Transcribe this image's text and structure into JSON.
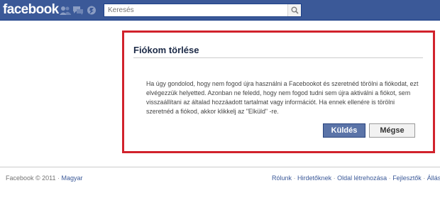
{
  "header": {
    "logo": "facebook",
    "search": {
      "placeholder": "Keresés",
      "value": ""
    }
  },
  "dialog": {
    "title": "Fiókom törlése",
    "body": "Ha úgy gondolod, hogy nem fogod újra használni a Facebookot és szeretnéd törölni a fiókodat, ezt elvégezzük helyetted. Azonban ne feledd, hogy nem fogod tudni sem újra aktiválni a fiókot, sem visszaállítani az általad hozzáadott tartalmat vagy információt. Ha ennek ellenére is törölni szeretnéd a fiókod, akkor klikkelj az \"Elküld\" -re.",
    "submit_label": "Küldés",
    "cancel_label": "Mégse"
  },
  "footer": {
    "copyright": "Facebook © 2011",
    "separator": "·",
    "language": "Magyar",
    "links": [
      "Rólunk",
      "Hirdetőknek",
      "Oldal létrehozása",
      "Fejlesztők",
      "Álláslehe"
    ]
  },
  "colors": {
    "brand": "#3b5998",
    "highlight_border": "#d1222c",
    "primary_button": "#5b74a8"
  },
  "icons": [
    "friend-requests-icon",
    "messages-icon",
    "notifications-icon",
    "search-icon"
  ]
}
